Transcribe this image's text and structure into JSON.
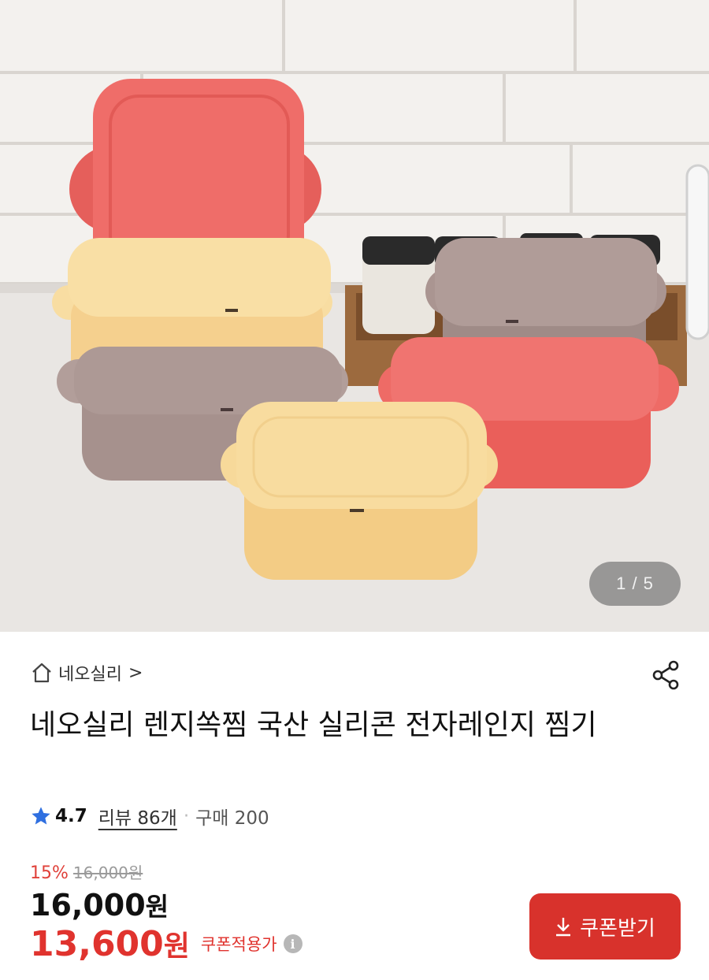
{
  "gallery": {
    "image_alt": "",
    "pager_text": "1 / 5"
  },
  "product": {
    "brand_name": "네오실리",
    "brand_chevron": ">",
    "title": "네오실리 렌지쏙찜 국산 실리콘 전자레인지 찜기",
    "rating": "4.7",
    "review_text": "리뷰 86개",
    "separator": "·",
    "purchase_text": "구매 200"
  },
  "price": {
    "discount_percent": "15%",
    "original_price": "16,000원",
    "sale_price_number": "16,000",
    "sale_price_unit": "원",
    "coupon_price_number": "13,600",
    "coupon_price_unit": "원",
    "coupon_applied_label": "쿠폰적용가",
    "info_icon_glyph": "i"
  },
  "actions": {
    "coupon_button_label": "쿠폰받기"
  },
  "icons": {
    "home": "home-icon",
    "share": "share-icon",
    "star": "star-icon",
    "info": "info-icon",
    "download": "download-icon"
  },
  "colors": {
    "accent_red": "#d8322c",
    "price_red": "#e0332e",
    "star_blue": "#2f6fe0",
    "coral": "#ee6f6a",
    "butter": "#f6d394",
    "mauve": "#a89490"
  }
}
